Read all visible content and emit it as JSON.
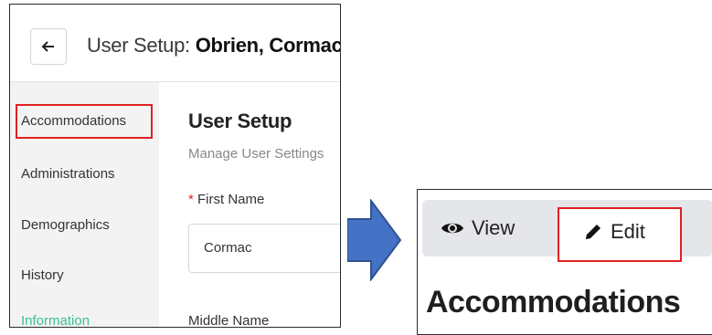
{
  "header": {
    "title_prefix": "User Setup: ",
    "title_name": "Obrien, Cormac"
  },
  "sidebar": {
    "items": [
      {
        "label": "Accommodations"
      },
      {
        "label": "Administrations"
      },
      {
        "label": "Demographics"
      },
      {
        "label": "History"
      },
      {
        "label": "Information"
      }
    ]
  },
  "main": {
    "section_title": "User Setup",
    "section_subtitle": "Manage User Settings",
    "first_name_label": "First Name",
    "first_name_required": "*",
    "first_name_value": "Cormac",
    "middle_name_label": "Middle Name"
  },
  "zoom": {
    "view_label": "View",
    "edit_label": "Edit",
    "heading": "Accommodations"
  },
  "colors": {
    "highlight": "#e02020",
    "arrow": "#4472c4",
    "active_sidebar": "#3fbf95"
  }
}
